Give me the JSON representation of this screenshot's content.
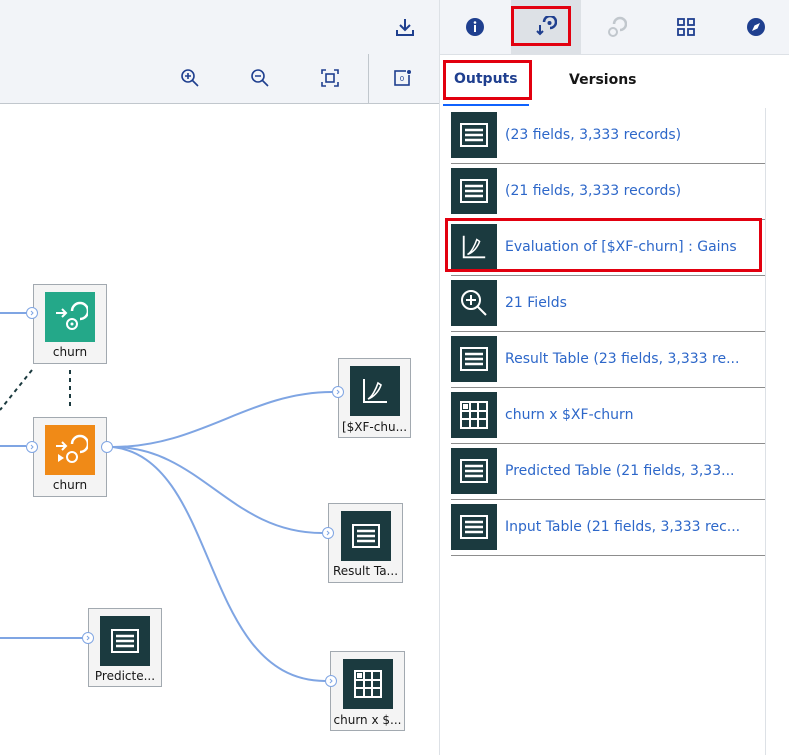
{
  "canvas": {
    "nodes": {
      "model_churn": {
        "label": "churn"
      },
      "apply_churn": {
        "label": "churn"
      },
      "evaluation": {
        "label": "[$XF-chu..."
      },
      "result_table": {
        "label": "Result Ta..."
      },
      "predicted_table": {
        "label": "Predicte..."
      },
      "matrix": {
        "label": "churn x $..."
      }
    }
  },
  "panel": {
    "tabs": [
      "Outputs",
      "Versions"
    ],
    "active_tab": "Outputs",
    "outputs": [
      {
        "icon": "table-icon",
        "label": "(23 fields, 3,333 records)"
      },
      {
        "icon": "table-icon",
        "label": "(21 fields, 3,333 records)"
      },
      {
        "icon": "evaluation-chart-icon",
        "label": "Evaluation of [$XF-churn] : Gains"
      },
      {
        "icon": "zoom-in-icon",
        "label": "21 Fields"
      },
      {
        "icon": "table-icon",
        "label": "Result Table (23 fields, 3,333 re..."
      },
      {
        "icon": "matrix-icon",
        "label": "churn x $XF-churn"
      },
      {
        "icon": "table-icon",
        "label": "Predicted Table (21 fields, 3,33..."
      },
      {
        "icon": "table-icon",
        "label": "Input Table (21 fields, 3,333 rec..."
      }
    ]
  },
  "colors": {
    "model_node": "#24a889",
    "apply_node": "#f08a17",
    "output_icon_bg": "#1b3a3f",
    "link": "#2d67c9",
    "highlight": "#e2000f"
  }
}
